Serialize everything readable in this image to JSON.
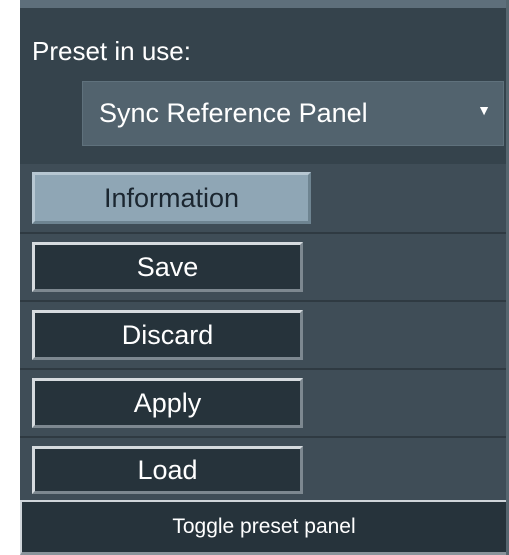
{
  "header": {
    "preset_label": "Preset in use:",
    "preset_selected": "Sync Reference Panel",
    "dropdown_arrow": "▼"
  },
  "buttons": {
    "information": "Information",
    "save": "Save",
    "discard": "Discard",
    "apply": "Apply",
    "load": "Load"
  },
  "footer": {
    "toggle_label": "Toggle preset panel"
  },
  "colors": {
    "panel_bg": "#3f4d57",
    "header_bg": "#35434c",
    "select_bg": "#52636e",
    "button_bg": "#26333b",
    "active_button_bg": "#8fa6b5"
  }
}
